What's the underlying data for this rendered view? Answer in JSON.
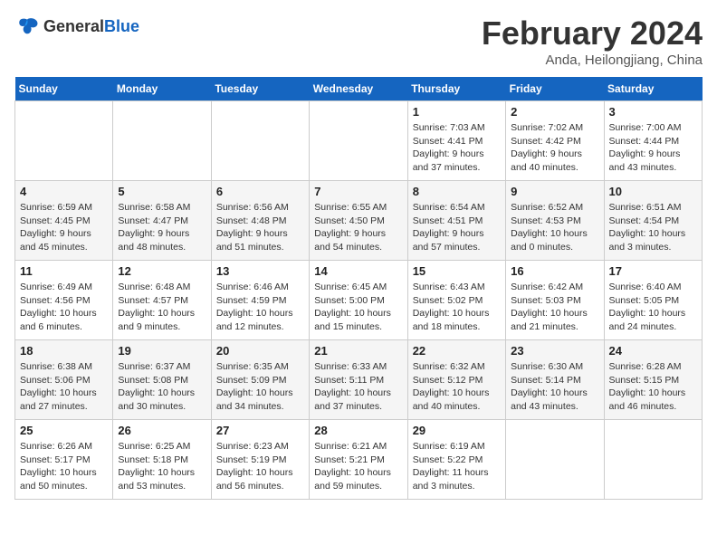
{
  "header": {
    "logo_general": "General",
    "logo_blue": "Blue",
    "month_title": "February 2024",
    "location": "Anda, Heilongjiang, China"
  },
  "calendar": {
    "weekdays": [
      "Sunday",
      "Monday",
      "Tuesday",
      "Wednesday",
      "Thursday",
      "Friday",
      "Saturday"
    ],
    "weeks": [
      [
        {
          "day": "",
          "info": ""
        },
        {
          "day": "",
          "info": ""
        },
        {
          "day": "",
          "info": ""
        },
        {
          "day": "",
          "info": ""
        },
        {
          "day": "1",
          "info": "Sunrise: 7:03 AM\nSunset: 4:41 PM\nDaylight: 9 hours\nand 37 minutes."
        },
        {
          "day": "2",
          "info": "Sunrise: 7:02 AM\nSunset: 4:42 PM\nDaylight: 9 hours\nand 40 minutes."
        },
        {
          "day": "3",
          "info": "Sunrise: 7:00 AM\nSunset: 4:44 PM\nDaylight: 9 hours\nand 43 minutes."
        }
      ],
      [
        {
          "day": "4",
          "info": "Sunrise: 6:59 AM\nSunset: 4:45 PM\nDaylight: 9 hours\nand 45 minutes."
        },
        {
          "day": "5",
          "info": "Sunrise: 6:58 AM\nSunset: 4:47 PM\nDaylight: 9 hours\nand 48 minutes."
        },
        {
          "day": "6",
          "info": "Sunrise: 6:56 AM\nSunset: 4:48 PM\nDaylight: 9 hours\nand 51 minutes."
        },
        {
          "day": "7",
          "info": "Sunrise: 6:55 AM\nSunset: 4:50 PM\nDaylight: 9 hours\nand 54 minutes."
        },
        {
          "day": "8",
          "info": "Sunrise: 6:54 AM\nSunset: 4:51 PM\nDaylight: 9 hours\nand 57 minutes."
        },
        {
          "day": "9",
          "info": "Sunrise: 6:52 AM\nSunset: 4:53 PM\nDaylight: 10 hours\nand 0 minutes."
        },
        {
          "day": "10",
          "info": "Sunrise: 6:51 AM\nSunset: 4:54 PM\nDaylight: 10 hours\nand 3 minutes."
        }
      ],
      [
        {
          "day": "11",
          "info": "Sunrise: 6:49 AM\nSunset: 4:56 PM\nDaylight: 10 hours\nand 6 minutes."
        },
        {
          "day": "12",
          "info": "Sunrise: 6:48 AM\nSunset: 4:57 PM\nDaylight: 10 hours\nand 9 minutes."
        },
        {
          "day": "13",
          "info": "Sunrise: 6:46 AM\nSunset: 4:59 PM\nDaylight: 10 hours\nand 12 minutes."
        },
        {
          "day": "14",
          "info": "Sunrise: 6:45 AM\nSunset: 5:00 PM\nDaylight: 10 hours\nand 15 minutes."
        },
        {
          "day": "15",
          "info": "Sunrise: 6:43 AM\nSunset: 5:02 PM\nDaylight: 10 hours\nand 18 minutes."
        },
        {
          "day": "16",
          "info": "Sunrise: 6:42 AM\nSunset: 5:03 PM\nDaylight: 10 hours\nand 21 minutes."
        },
        {
          "day": "17",
          "info": "Sunrise: 6:40 AM\nSunset: 5:05 PM\nDaylight: 10 hours\nand 24 minutes."
        }
      ],
      [
        {
          "day": "18",
          "info": "Sunrise: 6:38 AM\nSunset: 5:06 PM\nDaylight: 10 hours\nand 27 minutes."
        },
        {
          "day": "19",
          "info": "Sunrise: 6:37 AM\nSunset: 5:08 PM\nDaylight: 10 hours\nand 30 minutes."
        },
        {
          "day": "20",
          "info": "Sunrise: 6:35 AM\nSunset: 5:09 PM\nDaylight: 10 hours\nand 34 minutes."
        },
        {
          "day": "21",
          "info": "Sunrise: 6:33 AM\nSunset: 5:11 PM\nDaylight: 10 hours\nand 37 minutes."
        },
        {
          "day": "22",
          "info": "Sunrise: 6:32 AM\nSunset: 5:12 PM\nDaylight: 10 hours\nand 40 minutes."
        },
        {
          "day": "23",
          "info": "Sunrise: 6:30 AM\nSunset: 5:14 PM\nDaylight: 10 hours\nand 43 minutes."
        },
        {
          "day": "24",
          "info": "Sunrise: 6:28 AM\nSunset: 5:15 PM\nDaylight: 10 hours\nand 46 minutes."
        }
      ],
      [
        {
          "day": "25",
          "info": "Sunrise: 6:26 AM\nSunset: 5:17 PM\nDaylight: 10 hours\nand 50 minutes."
        },
        {
          "day": "26",
          "info": "Sunrise: 6:25 AM\nSunset: 5:18 PM\nDaylight: 10 hours\nand 53 minutes."
        },
        {
          "day": "27",
          "info": "Sunrise: 6:23 AM\nSunset: 5:19 PM\nDaylight: 10 hours\nand 56 minutes."
        },
        {
          "day": "28",
          "info": "Sunrise: 6:21 AM\nSunset: 5:21 PM\nDaylight: 10 hours\nand 59 minutes."
        },
        {
          "day": "29",
          "info": "Sunrise: 6:19 AM\nSunset: 5:22 PM\nDaylight: 11 hours\nand 3 minutes."
        },
        {
          "day": "",
          "info": ""
        },
        {
          "day": "",
          "info": ""
        }
      ]
    ]
  }
}
